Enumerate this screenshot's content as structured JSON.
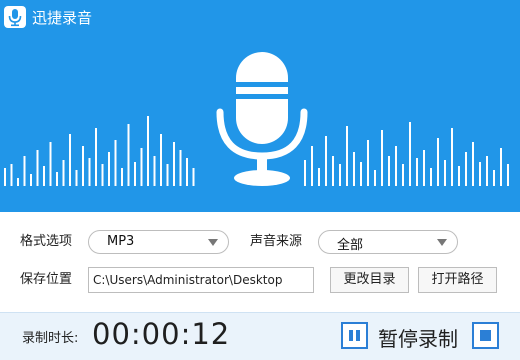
{
  "app": {
    "title": "迅捷录音"
  },
  "colors": {
    "hero_bg": "#2196e8",
    "accent": "#2b7fd6",
    "bottom_bg": "#eaf3fb"
  },
  "icons": {
    "logo": "microphone-icon",
    "pause": "pause-icon",
    "stop": "stop-icon"
  },
  "settings": {
    "format_label": "格式选项",
    "format_value": "MP3",
    "source_label": "声音来源",
    "source_value": "全部",
    "save_label": "保存位置",
    "save_path": "C:\\Users\\Administrator\\Desktop",
    "change_dir_button": "更改目录",
    "open_path_button": "打开路径"
  },
  "recording": {
    "duration_label": "录制时长:",
    "duration_value": "00:00:12",
    "pause_label": "暂停录制"
  }
}
